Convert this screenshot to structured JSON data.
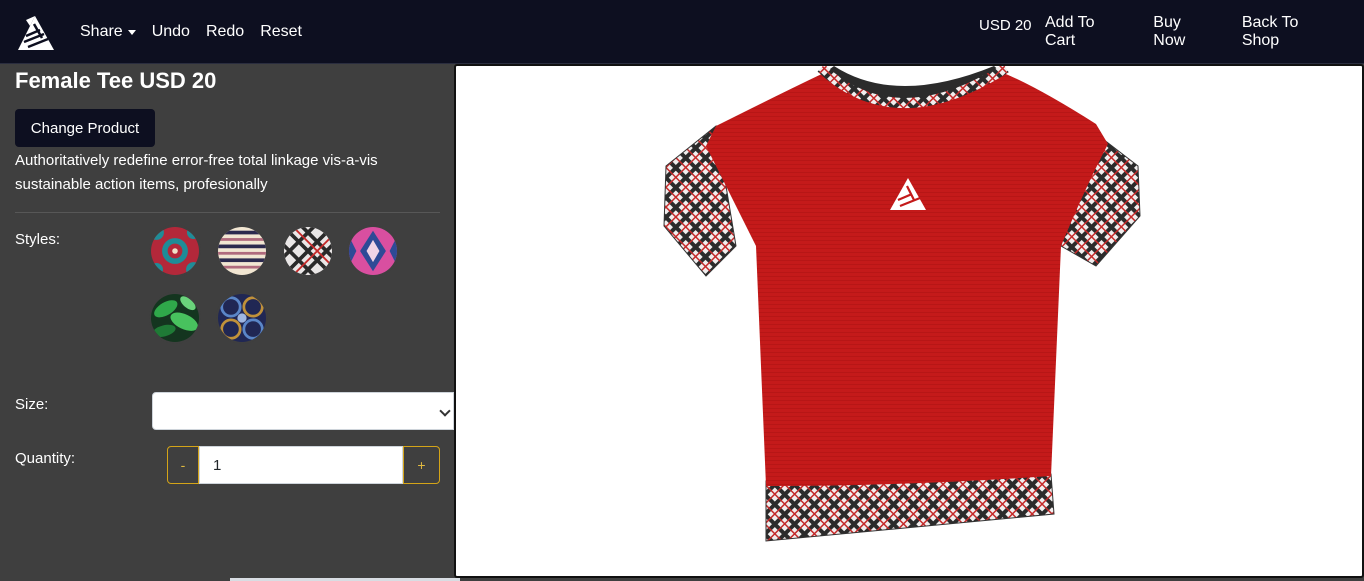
{
  "navbar": {
    "logo_icon": "zebra-logo-icon",
    "share_label": "Share",
    "undo_label": "Undo",
    "redo_label": "Redo",
    "reset_label": "Reset",
    "price_label": "USD 20",
    "add_to_cart_label": "Add To Cart",
    "buy_now_label": "Buy Now",
    "back_to_shop_label": "Back To Shop",
    "background_color": "#0d0f20"
  },
  "product": {
    "title": "Female Tee USD 20",
    "change_button_label": "Change Product",
    "description": "Authoritatively redefine error-free total linkage vis-a-vis sustainable action items, profesionally"
  },
  "styles": {
    "label": "Styles:",
    "swatches": [
      {
        "name": "teal-red-african-print"
      },
      {
        "name": "cream-navy-stripe"
      },
      {
        "name": "red-black-white-plaid"
      },
      {
        "name": "pink-blue-ikat"
      },
      {
        "name": "green-tropical-leaves"
      },
      {
        "name": "navy-circle-print"
      }
    ]
  },
  "size": {
    "label": "Size:",
    "value": ""
  },
  "quantity": {
    "label": "Quantity:",
    "minus_label": "-",
    "plus_label": "+",
    "value": "1",
    "accent_color": "#d4a418"
  },
  "preview": {
    "garment_color": "#c41a1a",
    "trim_pattern": "red-black-white-plaid",
    "logo_icon": "zebra-logo-icon"
  }
}
